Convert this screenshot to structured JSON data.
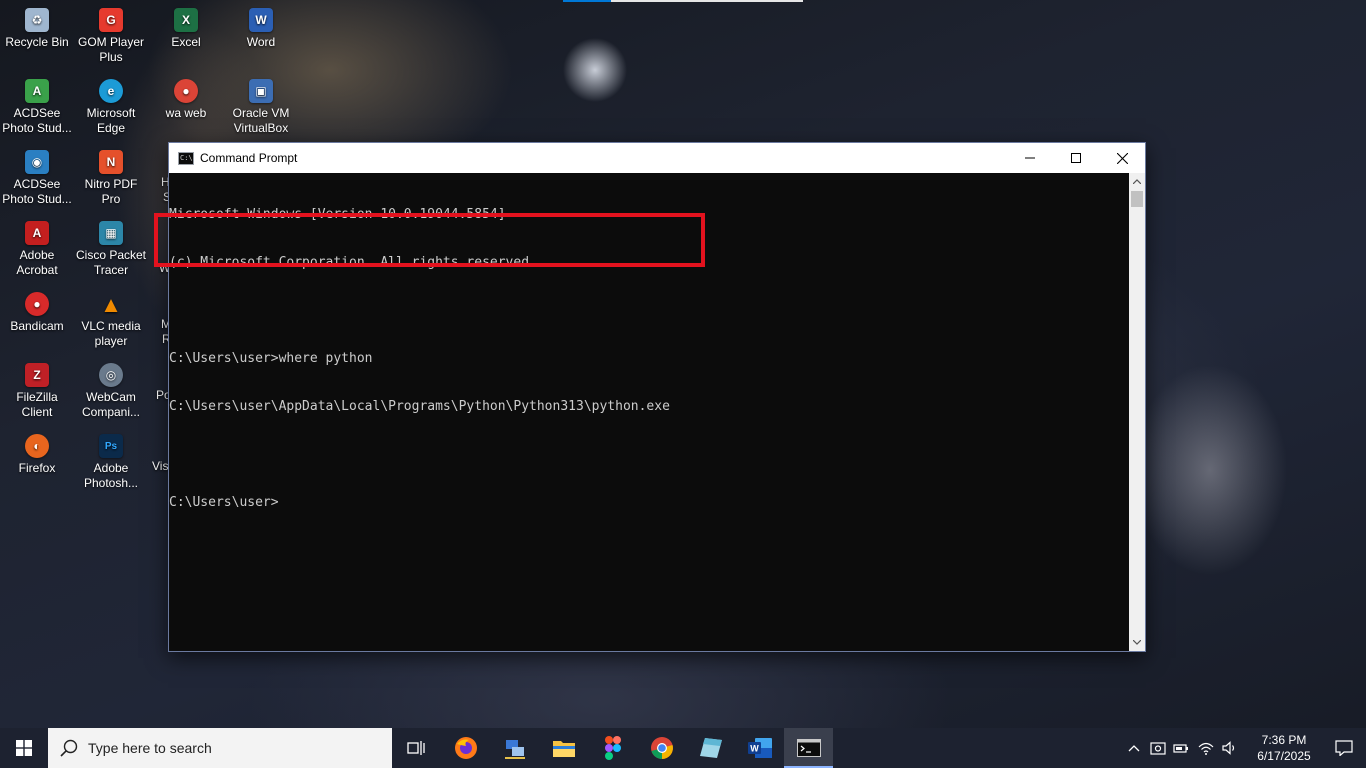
{
  "desktop_icons": [
    {
      "label": "Recycle Bin",
      "icon": "recycle-bin-icon",
      "color": "#9fb6cf",
      "glyph": "♻"
    },
    {
      "label": "GOM Player Plus",
      "icon": "gom-player-icon",
      "color": "#e63a2e",
      "glyph": "G"
    },
    {
      "label": "Excel",
      "icon": "excel-icon",
      "color": "#1d7044",
      "glyph": "X"
    },
    {
      "label": "Word",
      "icon": "word-icon",
      "color": "#2b5fb4",
      "glyph": "W"
    },
    {
      "label": "ACDSee Photo Stud...",
      "icon": "acdsee-icon",
      "color": "#3aa14a",
      "glyph": "A"
    },
    {
      "label": "Microsoft Edge",
      "icon": "edge-icon",
      "color": "#1c9bd6",
      "glyph": "e"
    },
    {
      "label": "wa web",
      "icon": "chrome-icon",
      "color": "#db4437",
      "glyph": "●"
    },
    {
      "label": "Oracle VM VirtualBox",
      "icon": "virtualbox-icon",
      "color": "#3c6db3",
      "glyph": "▣"
    },
    {
      "label": "ACDSee Photo Stud...",
      "icon": "acdsee-pro-icon",
      "color": "#2a7fc2",
      "glyph": "◉"
    },
    {
      "label": "Nitro PDF Pro",
      "icon": "nitro-pdf-icon",
      "color": "#e5502b",
      "glyph": "N"
    },
    {
      "label": "Adobe Acrobat",
      "icon": "acrobat-icon",
      "color": "#c41f1f",
      "glyph": "A"
    },
    {
      "label": "Cisco Packet Tracer",
      "icon": "packet-tracer-icon",
      "color": "#2c86a8",
      "glyph": "▦"
    },
    {
      "label": "Bandicam",
      "icon": "bandicam-icon",
      "color": "#d82a2a",
      "glyph": "●"
    },
    {
      "label": "VLC media player",
      "icon": "vlc-icon",
      "color": "#f08a00",
      "glyph": "▲"
    },
    {
      "label": "FileZilla Client",
      "icon": "filezilla-icon",
      "color": "#bf2026",
      "glyph": "Z"
    },
    {
      "label": "WebCam Compani...",
      "icon": "webcam-icon",
      "color": "#6a7a8c",
      "glyph": "◎"
    },
    {
      "label": "Firefox",
      "icon": "firefox-icon",
      "color": "#e8651e",
      "glyph": "◐"
    },
    {
      "label": "Adobe Photosh...",
      "icon": "photoshop-icon",
      "color": "#0b2a4a",
      "glyph": "Ps"
    }
  ],
  "partial_labels": [
    "H",
    "S",
    "W",
    "M",
    "R",
    "Po",
    "Vis"
  ],
  "cmd": {
    "title": "Command Prompt",
    "app_icon_text": "C:\\",
    "lines": [
      "Microsoft Windows [Version 10.0.19044.5854]",
      "(c) Microsoft Corporation. All rights reserved.",
      "",
      "C:\\Users\\user>where python",
      "C:\\Users\\user\\AppData\\Local\\Programs\\Python\\Python313\\python.exe",
      "",
      "C:\\Users\\user>"
    ],
    "highlight_color": "#e3121e"
  },
  "taskbar": {
    "search_placeholder": "Type here to search",
    "apps": [
      {
        "icon": "task-view-icon",
        "glyph": "⧉"
      },
      {
        "icon": "firefox-icon",
        "glyph": "◐"
      },
      {
        "icon": "network-tool-icon",
        "glyph": "⊞"
      },
      {
        "icon": "file-explorer-icon",
        "glyph": "▬"
      },
      {
        "icon": "figma-icon",
        "glyph": "❖"
      },
      {
        "icon": "chrome-icon",
        "glyph": "●"
      },
      {
        "icon": "notes-app-icon",
        "glyph": "◆"
      },
      {
        "icon": "word-icon",
        "glyph": "W"
      },
      {
        "icon": "command-prompt-icon",
        "glyph": "C:\\"
      }
    ],
    "time": "7:36 PM",
    "date": "6/17/2025"
  }
}
